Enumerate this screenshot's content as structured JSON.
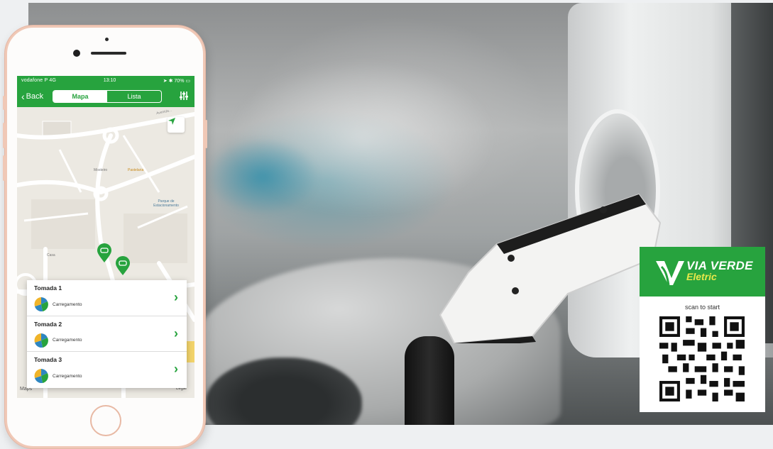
{
  "app": {
    "status_bar": {
      "carrier": "vodafone P  4G",
      "time": "13:10",
      "battery": "70%"
    },
    "nav": {
      "back_label": "Back",
      "tabs": [
        {
          "label": "Mapa",
          "active": true
        },
        {
          "label": "Lista",
          "active": false
        }
      ]
    },
    "map": {
      "labels": {
        "road": "Avenida...",
        "poi1": "Mosteiro",
        "poi2": "Pastelaria",
        "poi3": "Parque de Estacionamento",
        "poi4": "Casa"
      },
      "attribution": "Maps",
      "legal": "Legal"
    },
    "list": [
      {
        "title": "Tomada 1",
        "status": "Carregamento"
      },
      {
        "title": "Tomada 2",
        "status": "Carregamento"
      },
      {
        "title": "Tomada 3",
        "status": "Carregamento"
      }
    ]
  },
  "qr_card": {
    "brand_name": "VIA VERDE",
    "brand_sub": "Eletric",
    "caption": "scan to start"
  },
  "colors": {
    "brand_green": "#27a33e",
    "accent_yellow": "#e8e84a"
  },
  "icons": [
    "back-chevron-icon",
    "filter-sliders-icon",
    "locate-arrow-icon",
    "charging-pin-icon",
    "charger-status-icon",
    "chevron-right-icon",
    "qr-code-icon"
  ]
}
